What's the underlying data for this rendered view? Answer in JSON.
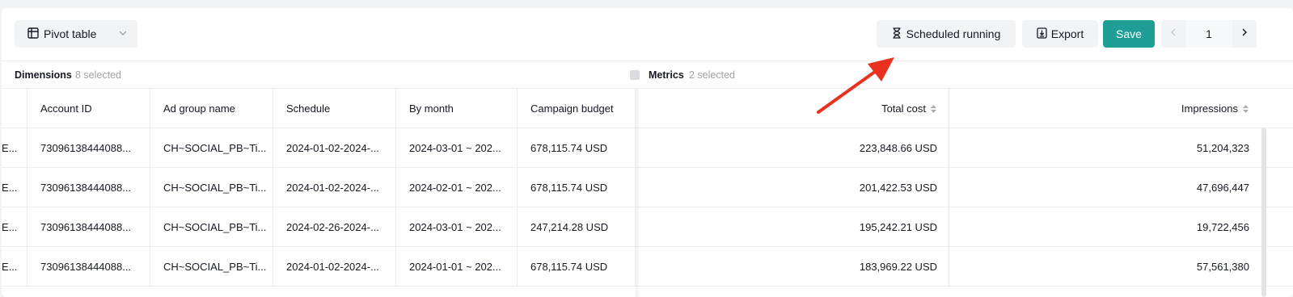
{
  "toolbar": {
    "pivot_label": "Pivot table",
    "scheduled_label": "Scheduled running",
    "export_label": "Export",
    "save_label": "Save",
    "page_number": "1"
  },
  "sections": {
    "dimensions_label": "Dimensions",
    "dimensions_count": "8 selected",
    "metrics_label": "Metrics",
    "metrics_count": "2 selected"
  },
  "table": {
    "headers": [
      "",
      "Account ID",
      "Ad group name",
      "Schedule",
      "By month",
      "Campaign budget",
      "Total cost",
      "Impressions"
    ],
    "rows": [
      [
        "E...",
        "73096138444088...",
        "CH~SOCIAL_PB~Ti...",
        "2024-01-02-2024-...",
        "2024-03-01 ~ 202...",
        "678,115.74 USD",
        "223,848.66 USD",
        "51,204,323"
      ],
      [
        "E...",
        "73096138444088...",
        "CH~SOCIAL_PB~Ti...",
        "2024-01-02-2024-...",
        "2024-02-01 ~ 202...",
        "678,115.74 USD",
        "201,422.53 USD",
        "47,696,447"
      ],
      [
        "E...",
        "73096138444088...",
        "CH~SOCIAL_PB~Ti...",
        "2024-02-26-2024-...",
        "2024-03-01 ~ 202...",
        "247,214.28 USD",
        "195,242.21 USD",
        "19,722,456"
      ],
      [
        "E...",
        "73096138444088...",
        "CH~SOCIAL_PB~Ti...",
        "2024-01-02-2024-...",
        "2024-01-01 ~ 202...",
        "678,115.74 USD",
        "183,969.22 USD",
        "57,561,380"
      ]
    ]
  },
  "colors": {
    "accent": "#1f9e95",
    "annotation_arrow": "#e8321f"
  }
}
